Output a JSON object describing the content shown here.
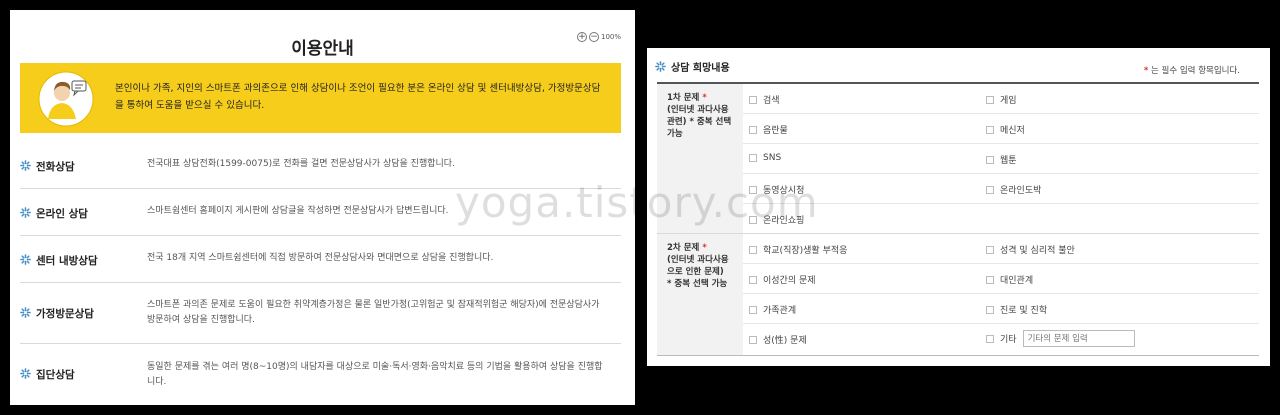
{
  "left": {
    "title": "이용안내",
    "zoom": {
      "plus": "+",
      "minus": "−",
      "level": "100%"
    },
    "banner": "본인이나 가족, 지인의 스마트폰 과의존으로 인해 상담이나 조언이 필요한 분은 온라인 상담 및 센터내방상담, 가정방문상담을 통하여 도움을 받으실 수 있습니다.",
    "rows": [
      {
        "label": "전화상담",
        "desc": "전국대표 상담전화(1599-0075)로 전화를 걸면 전문상담사가 상담을 진행합니다."
      },
      {
        "label": "온라인 상담",
        "desc": "스마트쉼센터 홈페이지 게시판에 상담글을 작성하면 전문상담사가 답변드립니다."
      },
      {
        "label": "센터 내방상담",
        "desc": "전국 18개 지역 스마트쉼센터에 직접 방문하여 전문상담사와 면대면으로 상담을 진행합니다."
      },
      {
        "label": "가정방문상담",
        "desc": "스마트폰 과의존 문제로 도움이 필요한 취약계층가정은 물론 일반가정(고위험군 및 잠재적위험군 해당자)에 전문상담사가 방문하여 상담을 진행합니다."
      },
      {
        "label": "집단상담",
        "desc": "동일한 문제를 겪는 여러 명(8~10명)의 내담자를 대상으로 미술·독서·영화·음악치료 등의 기법을 활용하여 상담을 진행합니다."
      }
    ]
  },
  "right": {
    "title": "상담 희망내용",
    "required_note": "는 필수 입력 항목입니다.",
    "required_mark": "*",
    "section1": {
      "label_line1": "1차 문제",
      "label_line2": "(인터넷 과다사용",
      "label_line3": "관련)",
      "label_line3_suffix": "* 중복 선택",
      "label_line4": "가능",
      "options": [
        "검색",
        "게임",
        "음란물",
        "메신저",
        "SNS",
        "웹툰",
        "동영상시청",
        "온라인도박",
        "온라인쇼핑"
      ]
    },
    "section2": {
      "label_line1": "2차 문제",
      "label_line2": "(인터넷 과다사용",
      "label_line3": "으로 인한 문제)",
      "label_line4": "* 중복 선택 가능",
      "options": [
        "학교(직장)생활 부적응",
        "성격 및 심리적 불안",
        "이성간의 문제",
        "대인관계",
        "가족관계",
        "진로 및 진학",
        "성(性) 문제",
        "기타"
      ],
      "other_placeholder": "기타의 문제 입력"
    }
  },
  "watermark": "yoga.tistory.com",
  "colors": {
    "banner": "#f6cd1a",
    "required": "#e03131",
    "icon_accent": "#4a90c8",
    "background": "#000000"
  }
}
